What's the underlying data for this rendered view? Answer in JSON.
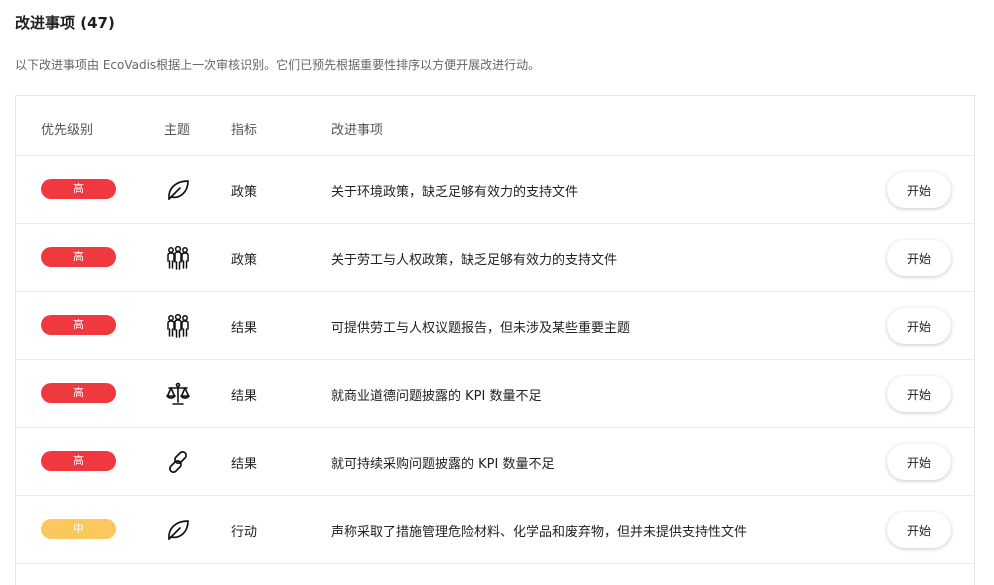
{
  "header": {
    "title": "改进事项 (47)",
    "subtitle": "以下改进事项由 EcoVadis根据上一次审核识别。它们已预先根据重要性排序以方便开展改进行动。"
  },
  "table": {
    "columns": {
      "priority": "优先级别",
      "theme": "主题",
      "indicator": "指标",
      "item": "改进事项"
    },
    "rows": [
      {
        "priority": "高",
        "priority_level": "high",
        "theme_icon": "leaf-icon",
        "indicator": "政策",
        "description": "关于环境政策，缺乏足够有效力的支持文件",
        "action": "开始"
      },
      {
        "priority": "高",
        "priority_level": "high",
        "theme_icon": "people-group-icon",
        "indicator": "政策",
        "description": "关于劳工与人权政策，缺乏足够有效力的支持文件",
        "action": "开始"
      },
      {
        "priority": "高",
        "priority_level": "high",
        "theme_icon": "people-group-icon",
        "indicator": "结果",
        "description": "可提供劳工与人权议题报告，但未涉及某些重要主题",
        "action": "开始"
      },
      {
        "priority": "高",
        "priority_level": "high",
        "theme_icon": "scales-icon",
        "indicator": "结果",
        "description": "就商业道德问题披露的 KPI 数量不足",
        "action": "开始"
      },
      {
        "priority": "高",
        "priority_level": "high",
        "theme_icon": "chain-link-icon",
        "indicator": "结果",
        "description": "就可持续采购问题披露的 KPI 数量不足",
        "action": "开始"
      },
      {
        "priority": "中",
        "priority_level": "medium",
        "theme_icon": "leaf-icon",
        "indicator": "行动",
        "description": "声称采取了措施管理危险材料、化学品和废弃物，但并未提供支持性文件",
        "action": "开始"
      }
    ]
  },
  "colors": {
    "high": "#f0383f",
    "medium": "#fbc85e"
  }
}
